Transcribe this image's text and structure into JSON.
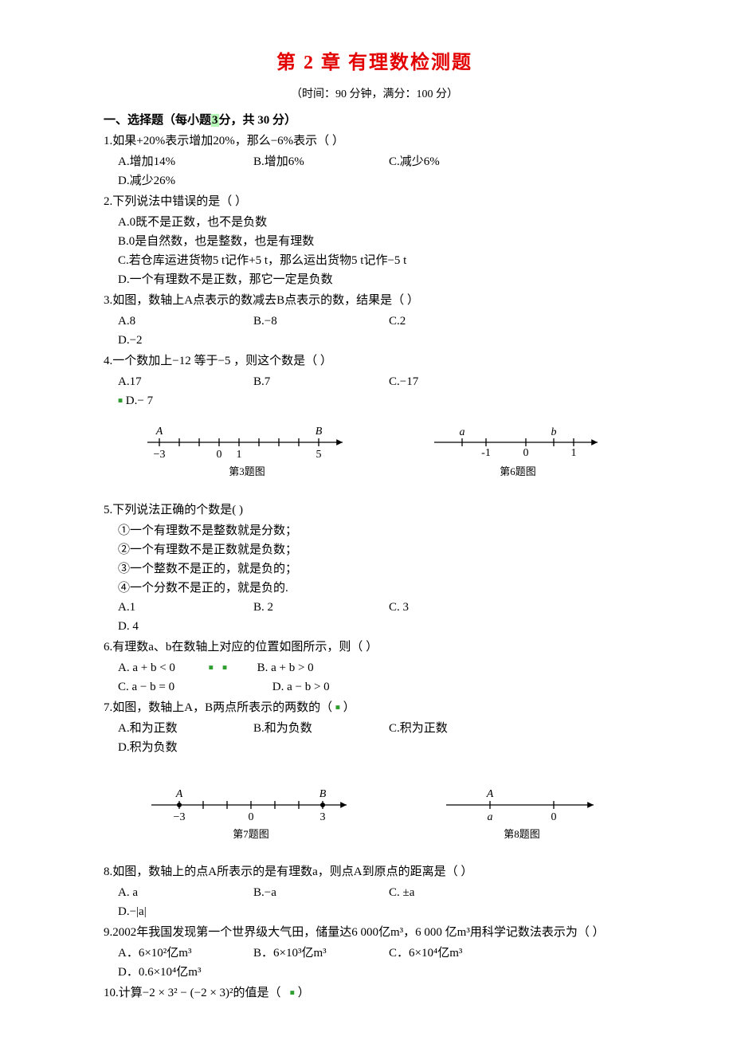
{
  "title": "第 2 章    有理数检测题",
  "subtitle": "（时间：90 分钟，满分：100 分）",
  "sectionHead": "一、选择题（每小题",
  "sectionHeadHL": "3",
  "sectionHeadTail": "分，共 30 分）",
  "q1": {
    "text": "1.如果+20%表示增加20%，那么−6%表示（    ）",
    "A": "A.增加14%",
    "B": "B.增加6%",
    "C": "C.减少6%",
    "D": "D.减少26%"
  },
  "q2": {
    "text": "2.下列说法中错误的是（    ）",
    "A": "A.0既不是正数，也不是负数",
    "B": "B.0是自然数，也是整数，也是有理数",
    "C": "C.若仓库运进货物5 t记作+5 t，那么运出货物5 t记作−5 t",
    "D": "D.一个有理数不是正数，那它一定是负数"
  },
  "q3": {
    "text": "3.如图，数轴上A点表示的数减去B点表示的数，结果是（    ）",
    "A": "A.8",
    "B": "B.−8",
    "C": "C.2",
    "D": "D.−2"
  },
  "q4": {
    "text": "4.一个数加上−12 等于−5 ，则这个数是（    ）",
    "A": "A.17",
    "B": "B.7",
    "C": "C.−17",
    "D": "D.− 7"
  },
  "fig3Label": "第3题图",
  "fig6Label": "第6题图",
  "fig3": {
    "Aletter": "A",
    "Aval": "−3",
    "zero": "0",
    "one": "1",
    "Bletter": "B",
    "Bval": "5"
  },
  "fig6": {
    "a": "a",
    "negone": "-1",
    "zero": "0",
    "b": "b",
    "one": "1"
  },
  "q5": {
    "text": "5.下列说法正确的个数是(        )",
    "s1": "①一个有理数不是整数就是分数；",
    "s2": "②一个有理数不是正数就是负数；",
    "s3": "③一个整数不是正的，就是负的；",
    "s4": "④一个分数不是正的，就是负的.",
    "A": "A.1",
    "B": "B. 2",
    "C": "C. 3",
    "D": "D. 4"
  },
  "q6": {
    "text": "6.有理数a、b在数轴上对应的位置如图所示，则（    ）",
    "A": "A. a + b < 0",
    "B": "B. a + b > 0",
    "C": "C. a − b = 0",
    "D": "D. a − b > 0"
  },
  "q7": {
    "text": "7.如图，数轴上A，B两点所表示的两数的（",
    "tail": "）",
    "A": "A.和为正数",
    "B": "B.和为负数",
    "C": "C.积为正数",
    "D": "D.积为负数"
  },
  "fig7Label": "第7题图",
  "fig8Label": "第8题图",
  "fig7": {
    "Aletter": "A",
    "Aval": "−3",
    "zero": "0",
    "Bletter": "B",
    "Bval": "3"
  },
  "fig8": {
    "Aletter": "A",
    "aval": "a",
    "zero": "0"
  },
  "q8": {
    "text": "8.如图，数轴上的点A所表示的是有理数a，则点A到原点的距离是（    ）",
    "A": "A. a",
    "B": "B.−a",
    "C": "C. ±a",
    "D": "D.−|a|"
  },
  "q9": {
    "text": "9.2002年我国发现第一个世界级大气田，储量达6 000亿m³，6 000 亿m³用科学记数法表示为（    ）",
    "A": "A．6×10²亿m³",
    "B": "B．6×10³亿m³",
    "C": "C．6×10⁴亿m³",
    "D": "D．0.6×10⁴亿m³"
  },
  "q10": {
    "text": "10.计算−2 × 3² − (−2 × 3)²的值是（",
    "tail": "）"
  }
}
